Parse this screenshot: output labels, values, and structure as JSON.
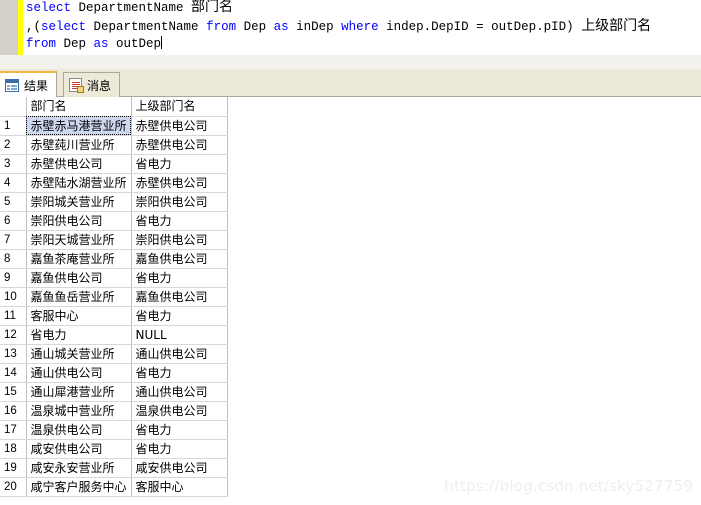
{
  "editor": {
    "lines": [
      [
        {
          "t": "select",
          "k": "kw"
        },
        {
          "t": " DepartmentName ",
          "k": "pl"
        },
        {
          "t": "部门名",
          "k": "cn"
        }
      ],
      [
        {
          "t": ",(",
          "k": "pl"
        },
        {
          "t": "select",
          "k": "kw"
        },
        {
          "t": " DepartmentName ",
          "k": "pl"
        },
        {
          "t": "from",
          "k": "kw"
        },
        {
          "t": " Dep ",
          "k": "pl"
        },
        {
          "t": "as",
          "k": "kw"
        },
        {
          "t": " inDep ",
          "k": "pl"
        },
        {
          "t": "where",
          "k": "kw"
        },
        {
          "t": " indep.DepID = outDep.pID) ",
          "k": "pl"
        },
        {
          "t": "上级部门名",
          "k": "cn"
        }
      ],
      [
        {
          "t": "from",
          "k": "kw"
        },
        {
          "t": " Dep ",
          "k": "pl"
        },
        {
          "t": "as",
          "k": "kw"
        },
        {
          "t": " outDep",
          "k": "pl"
        }
      ]
    ]
  },
  "tabs": [
    {
      "label": "结果",
      "icon": "grid-icon",
      "active": true
    },
    {
      "label": "消息",
      "icon": "message-icon",
      "active": false
    }
  ],
  "grid": {
    "columns": [
      "",
      "部门名",
      "上级部门名"
    ],
    "selected_cell": {
      "row": 0,
      "col": 1
    },
    "rows": [
      {
        "n": "1",
        "name": "赤壁赤马港营业所",
        "parent": "赤壁供电公司"
      },
      {
        "n": "2",
        "name": "赤壁莼川营业所",
        "parent": "赤壁供电公司"
      },
      {
        "n": "3",
        "name": "赤壁供电公司",
        "parent": "省电力"
      },
      {
        "n": "4",
        "name": "赤壁陆水湖营业所",
        "parent": "赤壁供电公司"
      },
      {
        "n": "5",
        "name": "崇阳城关营业所",
        "parent": "崇阳供电公司"
      },
      {
        "n": "6",
        "name": "崇阳供电公司",
        "parent": "省电力"
      },
      {
        "n": "7",
        "name": "崇阳天城营业所",
        "parent": "崇阳供电公司"
      },
      {
        "n": "8",
        "name": "嘉鱼茶庵营业所",
        "parent": "嘉鱼供电公司"
      },
      {
        "n": "9",
        "name": "嘉鱼供电公司",
        "parent": "省电力"
      },
      {
        "n": "10",
        "name": "嘉鱼鱼岳营业所",
        "parent": "嘉鱼供电公司"
      },
      {
        "n": "11",
        "name": "客服中心",
        "parent": "省电力"
      },
      {
        "n": "12",
        "name": "省电力",
        "parent": "NULL"
      },
      {
        "n": "13",
        "name": "通山城关营业所",
        "parent": "通山供电公司"
      },
      {
        "n": "14",
        "name": "通山供电公司",
        "parent": "省电力"
      },
      {
        "n": "15",
        "name": "通山犀港营业所",
        "parent": "通山供电公司"
      },
      {
        "n": "16",
        "name": "温泉城中营业所",
        "parent": "温泉供电公司"
      },
      {
        "n": "17",
        "name": "温泉供电公司",
        "parent": "省电力"
      },
      {
        "n": "18",
        "name": "咸安供电公司",
        "parent": "省电力"
      },
      {
        "n": "19",
        "name": "咸安永安营业所",
        "parent": "咸安供电公司"
      },
      {
        "n": "20",
        "name": "咸宁客户服务中心",
        "parent": "客服中心"
      }
    ]
  },
  "watermark": "https://blog.csdn.net/sky527759",
  "colors": {
    "keyword": "#0000ff",
    "change_bar": "#ffff00",
    "tab_active_top": "#f0b840",
    "selection": "#cdd7ef",
    "scrollbar_border": "#5679c0"
  }
}
